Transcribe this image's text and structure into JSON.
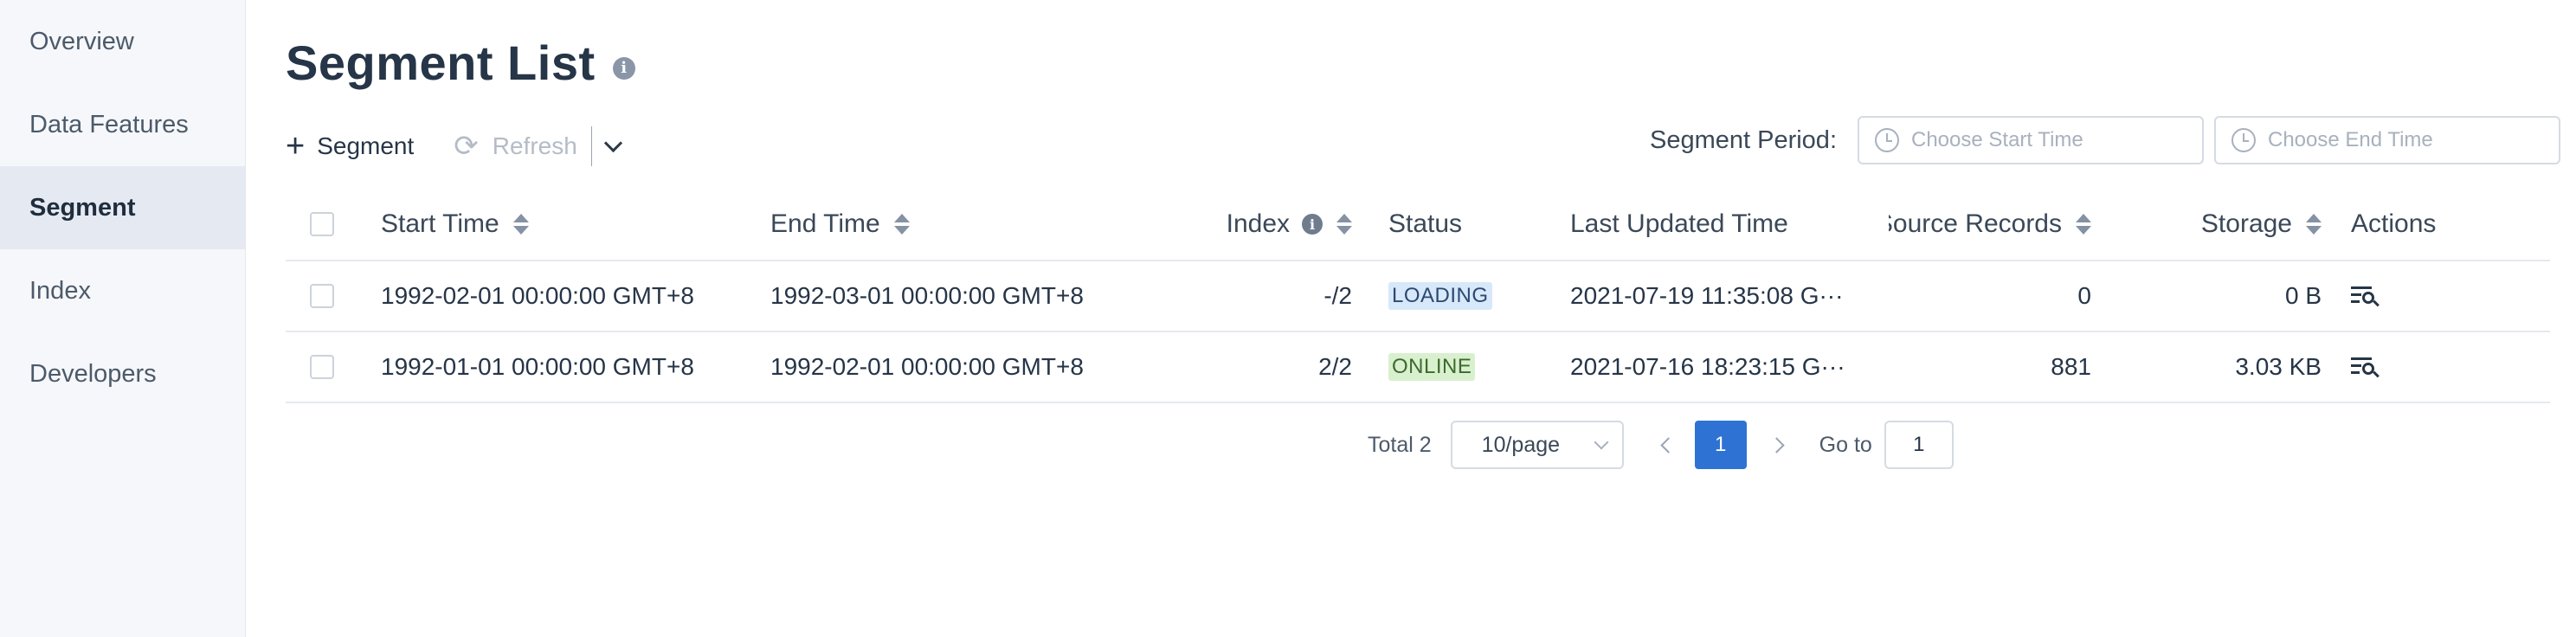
{
  "sidebar": {
    "items": [
      {
        "label": "Overview"
      },
      {
        "label": "Data Features"
      },
      {
        "label": "Segment"
      },
      {
        "label": "Index"
      },
      {
        "label": "Developers"
      }
    ],
    "active": "Segment"
  },
  "header": {
    "title": "Segment List",
    "info_glyph": "i"
  },
  "toolbar": {
    "add_glyph": "+",
    "add_label": "Segment",
    "refresh_glyph": "⟳",
    "refresh_label": "Refresh"
  },
  "period": {
    "label": "Segment Period:",
    "start_placeholder": "Choose Start Time",
    "end_placeholder": "Choose End Time"
  },
  "table": {
    "columns": {
      "start_time": "Start Time",
      "end_time": "End Time",
      "index": "Index",
      "status": "Status",
      "last_updated": "Last Updated Time",
      "source_records": "Source Records",
      "storage": "Storage",
      "actions": "Actions"
    },
    "info_glyph": "i",
    "rows": [
      {
        "start_time": "1992-02-01 00:00:00 GMT+8",
        "end_time": "1992-03-01 00:00:00 GMT+8",
        "index": "-/2",
        "status": "LOADING",
        "last_updated": "2021-07-19 11:35:08 G···",
        "source_records": "0",
        "storage": "0 B"
      },
      {
        "start_time": "1992-01-01 00:00:00 GMT+8",
        "end_time": "1992-02-01 00:00:00 GMT+8",
        "index": "2/2",
        "status": "ONLINE",
        "last_updated": "2021-07-16 18:23:15 G···",
        "source_records": "881",
        "storage": "3.03 KB"
      }
    ]
  },
  "pagination": {
    "total": "Total 2",
    "page_size": "10/page",
    "current_page": "1",
    "goto_label": "Go to",
    "goto_value": "1"
  },
  "colors": {
    "primary": "#2e73d4",
    "loading_tag_bg": "#d7e8fb",
    "online_tag_bg": "#d9f0cf",
    "sidebar_bg": "#f6f7fa",
    "sidebar_active_bg": "#e5e9f2"
  },
  "icons": {
    "title_info": "info-icon",
    "add": "plus-icon",
    "refresh": "refresh-icon",
    "dropdown": "chevron-down-icon",
    "time_input": "clock-icon",
    "sort": "sort-icon",
    "action": "view-detail-icon",
    "prev": "chevron-left-icon",
    "next": "chevron-right-icon"
  }
}
